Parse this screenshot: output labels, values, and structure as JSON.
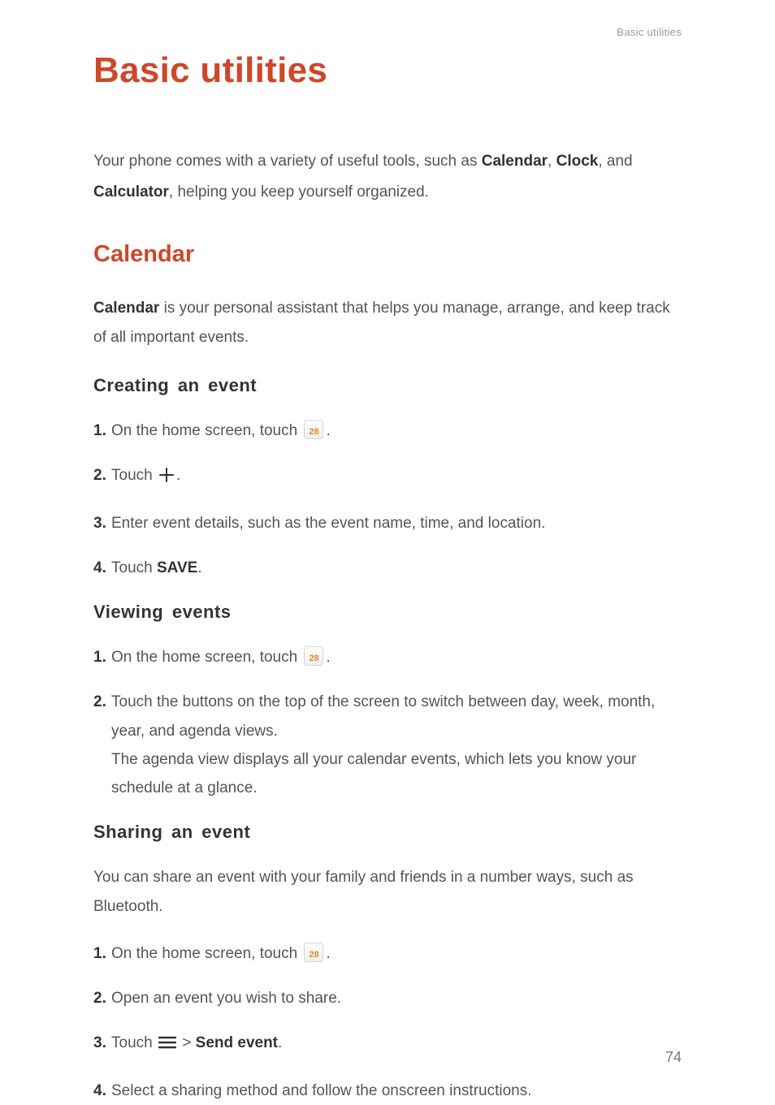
{
  "header": {
    "meta": "Basic utilities"
  },
  "title": "Basic utilities",
  "intro": {
    "p1a": "Your phone comes with a variety of useful tools, such as ",
    "b1": "Calendar",
    "p1b": ", ",
    "b2": "Clock",
    "p1c": ", and ",
    "b3": "Calculator",
    "p1d": ", helping you keep yourself organized."
  },
  "section1": {
    "heading": "Calendar",
    "intro_b": "Calendar",
    "intro_rest": " is your personal assistant that helps you manage, arrange, and keep track of all important events."
  },
  "creating": {
    "heading": "Creating an event",
    "s1": "On the home screen, touch ",
    "s1_after": ".",
    "s2": "Touch ",
    "s2_after": ".",
    "s3": "Enter event details, such as the event name, time, and location.",
    "s4a": "Touch ",
    "s4b": "SAVE",
    "s4c": "."
  },
  "viewing": {
    "heading": "Viewing events",
    "s1": "On the home screen, touch ",
    "s1_after": ".",
    "s2a": "Touch the buttons on the top of the screen to switch between day, week, month, year, and agenda views.",
    "s2b": "The agenda view displays all your calendar events, which lets you know your schedule at a glance."
  },
  "sharing": {
    "heading": "Sharing an event",
    "intro": "You can share an event with your family and friends in a number ways, such as Bluetooth.",
    "s1": "On the home screen, touch ",
    "s1_after": ".",
    "s2": "Open an event you wish to share.",
    "s3a": "Touch ",
    "s3_gt": " > ",
    "s3b": "Send event",
    "s3c": ".",
    "s4": "Select a sharing method and follow the onscreen instructions."
  },
  "page_number": "74"
}
